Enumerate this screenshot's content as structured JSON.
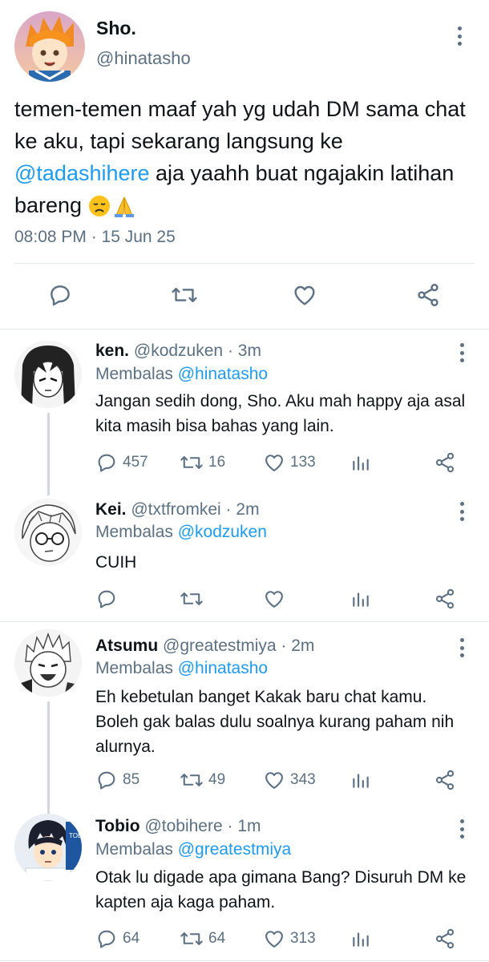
{
  "main_tweet": {
    "author_name": "Sho.",
    "handle": "@hinatasho",
    "text_before": "temen-temen maaf yah yg udah DM sama chat ke aku, tapi sekarang langsung ke ",
    "mention": "@tadashihere",
    "text_after": " aja yaahh buat ngajakin latihan bareng ",
    "emojis": [
      "disappointed-face",
      "folded-hands"
    ],
    "timestamp": "08:08 PM · 15 Jun 25",
    "actions": [
      "reply-icon",
      "retweet-icon",
      "like-icon",
      "share-icon"
    ]
  },
  "replying_prefix": "Membalas ",
  "replies": [
    {
      "name": "ken.",
      "handle": "@kodzuken",
      "dot": "·",
      "time": "3m",
      "reply_to": "@hinatasho",
      "text": "Jangan sedih dong, Sho. Aku mah happy aja asal kita masih bisa bahas yang lain.",
      "reply_count": "457",
      "retweet_count": "16",
      "like_count": "133"
    },
    {
      "name": "Kei.",
      "handle": "@txtfromkei",
      "dot": "·",
      "time": "2m",
      "reply_to": "@kodzuken",
      "text": "CUIH",
      "reply_count": "",
      "retweet_count": "",
      "like_count": ""
    },
    {
      "name": "Atsumu",
      "handle": "@greatestmiya",
      "dot": "·",
      "time": "2m",
      "reply_to": "@hinatasho",
      "text": "Eh kebetulan banget Kakak baru chat kamu. Boleh gak balas dulu soalnya kurang paham nih alurnya.",
      "reply_count": "85",
      "retweet_count": "49",
      "like_count": "343"
    },
    {
      "name": "Tobio",
      "handle": "@tobihere",
      "dot": "·",
      "time": "1m",
      "reply_to": "@greatestmiya",
      "text": "Otak lu digade apa gimana Bang? Disuruh DM ke kapten aja kaga paham.",
      "reply_count": "64",
      "retweet_count": "64",
      "like_count": "313"
    }
  ],
  "colors": {
    "link": "#1d9bf0",
    "secondary_text": "#5b7083",
    "primary_text": "#0f1419",
    "divider": "#e3e8ec"
  }
}
